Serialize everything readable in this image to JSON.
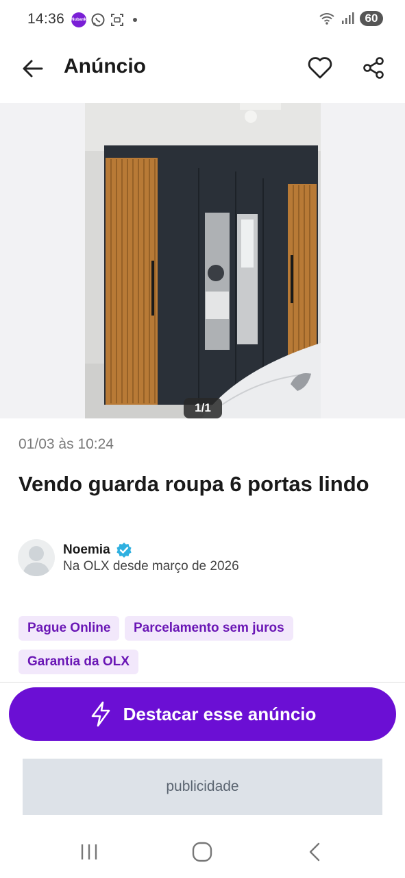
{
  "status_bar": {
    "time": "14:36",
    "app_badge_text": "Nubank",
    "battery": "60",
    "icons": [
      "app-badge-icon",
      "whatsapp-icon",
      "screenshot-icon",
      "wifi-icon",
      "signal-icon"
    ]
  },
  "header": {
    "title": "Anúncio",
    "icons": [
      "back-arrow-icon",
      "heart-icon",
      "share-icon"
    ]
  },
  "gallery": {
    "counter": "1/1"
  },
  "listing": {
    "date": "01/03 às 10:24",
    "title": "Vendo guarda roupa 6 portas lindo"
  },
  "seller": {
    "name": "Noemia",
    "since": "Na OLX desde março de 2026"
  },
  "tags": [
    "Pague Online",
    "Parcelamento sem juros",
    "Garantia da OLX"
  ],
  "cta": {
    "label": "Destacar esse anúncio"
  },
  "ad": {
    "label": "publicidade"
  },
  "colors": {
    "primary": "#6b0fd4",
    "tag_bg": "#f2e8fb",
    "tag_text": "#6a16b5",
    "verified": "#2fb0e0"
  }
}
